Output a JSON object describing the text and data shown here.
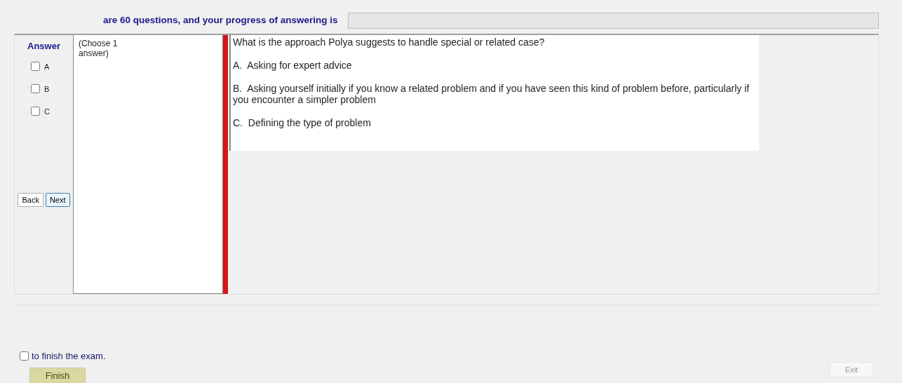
{
  "header": {
    "text": "are 60 questions, and your progress of answering is",
    "progress": {
      "level": 0
    }
  },
  "answer_panel": {
    "title": "Answer",
    "options": [
      {
        "label": "A",
        "checked": false
      },
      {
        "label": "B",
        "checked": false
      },
      {
        "label": "C",
        "checked": false
      }
    ],
    "buttons": [
      {
        "label": "Back"
      },
      {
        "label": "Next"
      }
    ]
  },
  "instruction": "(Choose 1 answer)",
  "question": {
    "text": "What is the approach Polya suggests to handle special or related case?",
    "choices": [
      "A.  Asking for expert advice",
      "B.  Asking yourself initially if you know a related problem and if you have seen this kind of problem before, particularly if you encounter a simpler problem",
      "C.  Defining the type of problem"
    ]
  },
  "finish": {
    "label": "to finish the exam.",
    "checked": false,
    "button": "Finish"
  },
  "exit": {
    "label": "Exit",
    "disabled": true
  }
}
